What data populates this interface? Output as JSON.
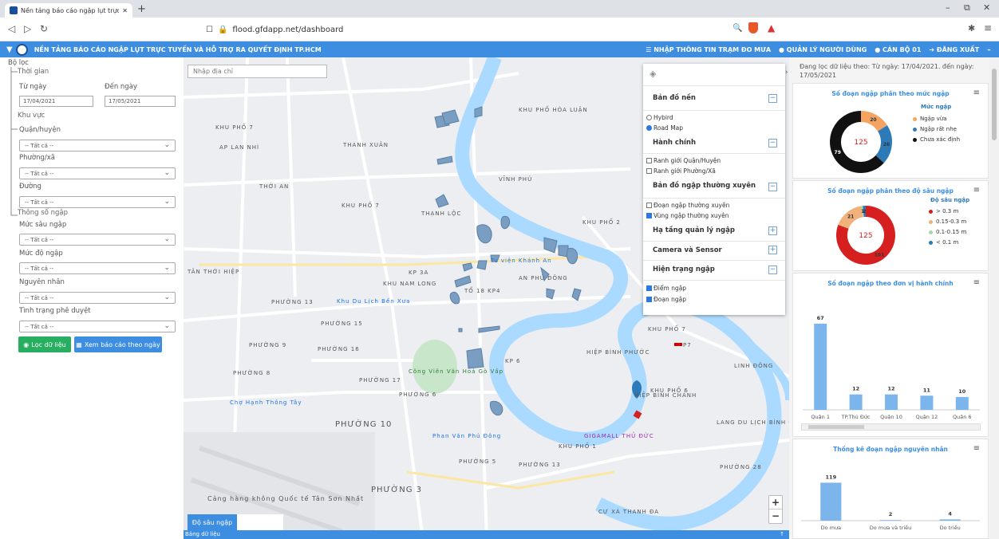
{
  "browser": {
    "tab_title": "Nền tảng báo cáo ngập lụt trực t…",
    "new_tab": "+",
    "url": "flood.gfdapp.net/dashboard",
    "win_min": "–",
    "win_max": "⧉",
    "win_close": "✕"
  },
  "appbar": {
    "title": "NỀN TẢNG BÁO CÁO NGẬP LỤT TRỰC TUYẾN VÀ HỖ TRỢ RA QUYẾT ĐỊNH TP.HCM",
    "menu": [
      "NHẬP THÔNG TIN TRẠM ĐO MƯA",
      "QUẢN LÝ NGƯỜI DÙNG",
      "CÁN BỘ 01",
      "ĐĂNG XUẤT"
    ]
  },
  "filter": {
    "title": "Bộ lọc",
    "time_group": "Thời gian",
    "from_label": "Từ ngày",
    "to_label": "Đến ngày",
    "from_value": "17/04/2021",
    "to_value": "17/05/2021",
    "area_group": "Khu vực",
    "district_label": "Quận/huyện",
    "ward_label": "Phường/xã",
    "street_label": "Đường",
    "all": "-- Tất cả --",
    "param_group": "Thông số ngập",
    "depth_label": "Mức sâu ngập",
    "level_label": "Mức độ ngập",
    "cause_label": "Nguyên nhân",
    "approval_label": "Tình trạng phê duyệt",
    "filter_btn": "Lọc dữ liệu",
    "report_btn": "Xem báo cáo theo ngày"
  },
  "map": {
    "search_placeholder": "Nhập địa chỉ",
    "legend_tab": "Độ sâu ngập",
    "data_tab": "Bảng dữ liệu",
    "zoom_in": "+",
    "zoom_out": "−",
    "places": [
      "KHU PHỐ HÒA LUẬN",
      "KHU PHỐ 7",
      "AP LAN NHÌ",
      "THANH XUÂN",
      "VĨNH PHÚ",
      "THỚI AN",
      "KHU PHỐ 7",
      "THẠNH LỘC",
      "KHU PHỐ 2",
      "KP 3A",
      "AN PHÚ ĐÔNG",
      "TÂN THỚI HIỆP",
      "KHU NAM LONG",
      "TỔ 18 KP4",
      "PHƯỜNG 13",
      "PHƯỜNG 15",
      "PHƯỜNG 9",
      "PHƯỜNG 16",
      "PHƯỜNG 8",
      "PHƯỜNG 17",
      "PHƯỜNG 6",
      "PHƯỜNG 10",
      "PHƯỜNG 5",
      "PHƯỜNG 13",
      "PHƯỜNG 3",
      "KP 6",
      "HIỆP BÌNH PHƯỚC",
      "LINH ĐÔNG",
      "KHU PHỐ 6",
      "HIỆP BÌNH CHÁNH",
      "LANG DU LỊCH BÌNH QUỚI",
      "GIGAMALL THỦ ĐỨC",
      "KHU PHỐ 1",
      "PHƯỜNG 28",
      "CƯ XÁ THANH ĐA",
      "Khu Du Lịch Bến Xưa",
      "Công Viên Văn Hoá Gò Vấp",
      "Chợ Hạnh Thông Tây",
      "Phan Văn Phú Đông",
      "Cảng hàng không Quốc tế Tân Sơn Nhất",
      "Tu viện Khánh An",
      "KHU PHỐ 7",
      "P7"
    ]
  },
  "layers": {
    "basemap": "Bản đồ nền",
    "hybrid": "Hybird",
    "roadmap": "Road Map",
    "admin": "Hành chính",
    "district_border": "Ranh giới Quận/Huyện",
    "ward_border": "Ranh giới Phường/Xã",
    "frequent": "Bản đồ ngập thường xuyên",
    "frequent_seg": "Đoạn ngập thường xuyên",
    "frequent_area": "Vùng ngập thường xuyên",
    "infra": "Hạ tầng quản lý ngập",
    "camera": "Camera và Sensor",
    "current": "Hiện trạng ngập",
    "points": "Điểm ngập",
    "segments": "Đoạn ngập"
  },
  "right": {
    "filter_info": "Đang lọc dữ liệu theo: Từ ngày: 17/04/2021. đến ngày: 17/05/2021"
  },
  "colors": {
    "primary": "#3d8ee0",
    "green": "#27ae60",
    "orange": "#f4a460",
    "blue": "#2d7ab8",
    "black": "#111111",
    "red": "#d62020",
    "lightorange": "#f0b27a",
    "lightgreen": "#a8d8a8",
    "bar": "#7cb5ec",
    "water": "#aadaff",
    "flood": "#7a9ec2"
  },
  "chart_data": [
    {
      "type": "pie",
      "title": "Số đoạn ngập phân theo mức ngập",
      "legend_title": "Mức ngập",
      "labels": [
        "Ngập vừa",
        "Ngập rất nhẹ",
        "Chưa xác định"
      ],
      "values": [
        20,
        26,
        79
      ],
      "colors": [
        "#f4a460",
        "#2d7ab8",
        "#111111"
      ],
      "center": "125"
    },
    {
      "type": "pie",
      "title": "Số đoạn ngập phân theo độ sâu ngập",
      "legend_title": "Độ sâu ngập",
      "labels": [
        "> 0.3 m",
        "0.15-0.3 m",
        "0.1-0.15 m",
        "< 0.1 m"
      ],
      "values": [
        101,
        21,
        1,
        2
      ],
      "colors": [
        "#d62020",
        "#f0b27a",
        "#a8d8a8",
        "#2d7ab8"
      ],
      "center": "125"
    },
    {
      "type": "bar",
      "title": "Số đoạn ngập theo đơn vị hành chính",
      "categories": [
        "Quận 1",
        "TP.Thủ Đức",
        "Quận 10",
        "Quận 12",
        "Quận 6"
      ],
      "values": [
        67,
        12,
        12,
        11,
        10
      ],
      "ylim": [
        0,
        75
      ]
    },
    {
      "type": "bar",
      "title": "Thống kê đoạn ngập nguyên nhân",
      "categories": [
        "Do mưa",
        "Do mưa và triều",
        "Do triều"
      ],
      "values": [
        119,
        2,
        4
      ],
      "ylim": [
        0,
        130
      ]
    }
  ]
}
